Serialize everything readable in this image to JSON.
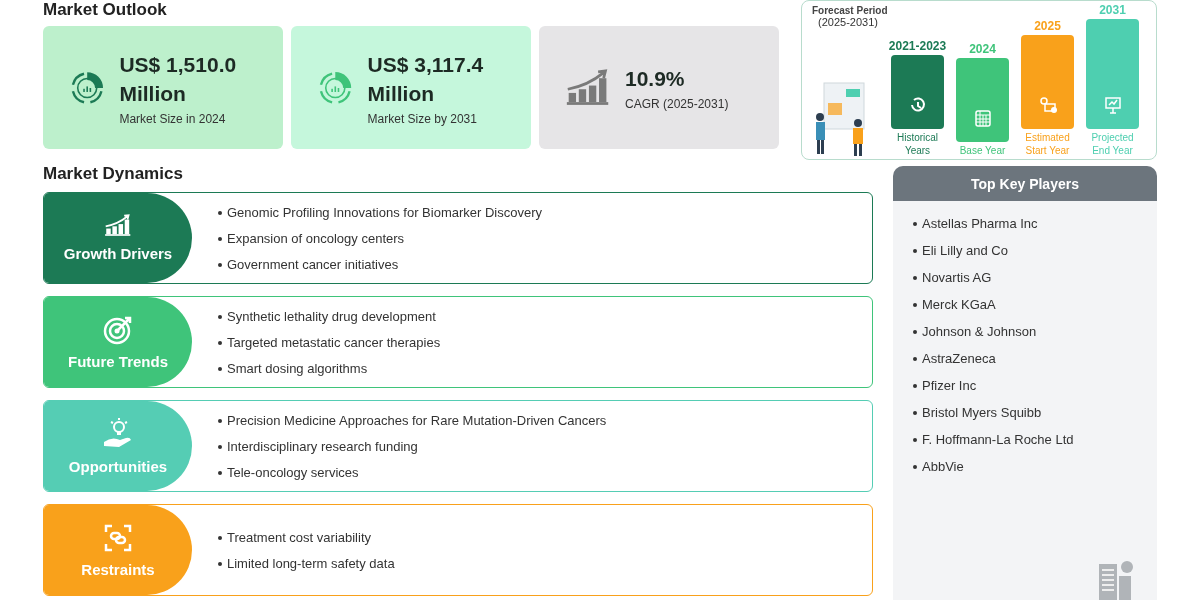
{
  "outlook": {
    "title": "Market Outlook",
    "cards": [
      {
        "kind": "donut",
        "value": "US$ 1,510.0 Million",
        "caption": "Market Size in 2024",
        "color": "#bdf0cc"
      },
      {
        "kind": "donut",
        "value": "US$ 3,117.4 Million",
        "caption": "Market Size by 2031",
        "color": "#c5f7dc"
      },
      {
        "kind": "growth",
        "value": "10.9%",
        "caption": "CAGR (2025-2031)",
        "color": "#e6e5e7"
      }
    ]
  },
  "forecast": {
    "title": "Forecast Period",
    "range": "(2025-2031)",
    "periods": [
      {
        "year": "2021-2023",
        "label": "Historical Years",
        "color": "#1c7a55"
      },
      {
        "year": "2024",
        "label": "Base Year",
        "color": "#3fc47a"
      },
      {
        "year": "2025",
        "label": "Estimated Start Year",
        "color": "#f9a11b"
      },
      {
        "year": "2031",
        "label": "Projected End Year",
        "color": "#4ecfb0"
      }
    ]
  },
  "dynamics": {
    "title": "Market Dynamics",
    "groups": [
      {
        "kind": "growth",
        "label": "Growth Drivers",
        "color": "#1c7a55",
        "items": [
          "Genomic Profiling Innovations for Biomarker Discovery",
          "Expansion of oncology centers",
          "Government cancer initiatives"
        ]
      },
      {
        "kind": "target",
        "label": "Future Trends",
        "color": "#3fc47a",
        "items": [
          "Synthetic lethality drug development",
          "Targeted metastatic cancer therapies",
          "Smart dosing algorithms"
        ]
      },
      {
        "kind": "idea",
        "label": "Opportunities",
        "color": "#55cdb4",
        "items": [
          "Precision Medicine Approaches for Rare Mutation-Driven Cancers",
          "Interdisciplinary research funding",
          "Tele-oncology services"
        ]
      },
      {
        "kind": "link",
        "label": "Restraints",
        "color": "#f9a11b",
        "items": [
          "Treatment cost variability",
          "Limited long-term safety data"
        ]
      }
    ]
  },
  "players": {
    "title": "Top Key Players",
    "items": [
      "Astellas Pharma Inc",
      "Eli Lilly and Co",
      "Novartis AG",
      "Merck KGaA",
      "Johnson & Johnson",
      "AstraZeneca",
      "Pfizer Inc",
      "Bristol Myers Squibb",
      "F. Hoffmann-La Roche Ltd",
      "AbbVie"
    ]
  }
}
